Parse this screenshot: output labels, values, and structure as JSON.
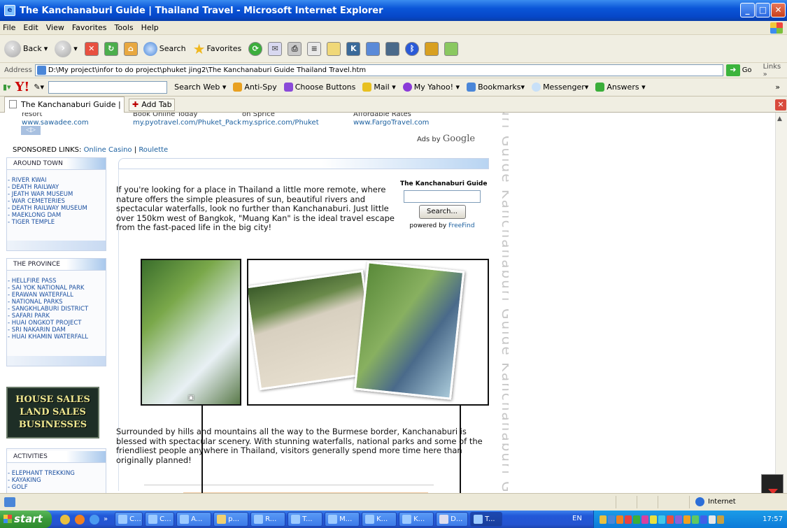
{
  "window": {
    "title": "The Kanchanaburi Guide | Thailand Travel - Microsoft Internet Explorer",
    "controls": [
      "_",
      "□",
      "✕"
    ]
  },
  "menu": [
    "File",
    "Edit",
    "View",
    "Favorites",
    "Tools",
    "Help"
  ],
  "toolbar": {
    "back": "Back",
    "search": "Search",
    "favorites": "Favorites"
  },
  "address": {
    "label": "Address",
    "value": "D:\\My project\\infor to do project\\phuket jing2\\The Kanchanaburi Guide  Thailand Travel.htm",
    "go": "Go",
    "links": "Links »"
  },
  "yahoo": {
    "logo": "Y!",
    "search_web": "Search Web ▾",
    "anti_spy": "Anti-Spy",
    "choose_buttons": "Choose Buttons",
    "mail": "Mail ▾",
    "my_yahoo": "My Yahoo! ▾",
    "bookmarks": "Bookmarks▾",
    "messenger": "Messenger▾",
    "answers": "Answers ▾",
    "more": "»"
  },
  "tabs": {
    "active": "The Kanchanaburi Guide | ...",
    "add": "Add Tab"
  },
  "ads": [
    {
      "line": "resort",
      "url": "www.sawadee.com"
    },
    {
      "line": "Book Online Today",
      "url": "my.pyotravel.com/Phuket_Pack"
    },
    {
      "line": "on Sprice",
      "url": "my.sprice.com/Phuket"
    },
    {
      "line": "Affordable Rates",
      "url": "www.FargoTravel.com"
    }
  ],
  "ads_by": "Ads by",
  "google": "Google",
  "sponsored": {
    "label": "SPONSORED LINKS:",
    "link1": "Online Casino",
    "sep": "|",
    "link2": "Roulette"
  },
  "sidebar": {
    "around_town": {
      "title": "AROUND TOWN",
      "items": [
        "- RIVER KWAI",
        "- DEATH RAILWAY",
        "- JEATH WAR MUSEUM",
        "- WAR CEMETERIES",
        "- DEATH RAILWAY MUSEUM",
        "- MAEKLONG DAM",
        "- TIGER TEMPLE"
      ]
    },
    "province": {
      "title": "THE PROVINCE",
      "items": [
        "- HELLFIRE PASS",
        "- SAI YOK NATIONAL PARK",
        "- ERAWAN WATERFALL",
        "- NATIONAL PARKS",
        "- SANGKHLABURI DISTRICT",
        "- SAFARI PARK",
        "- HUAI ONGKOT PROJECT",
        "- SRI NAKARIN DAM",
        "- HUAI KHAMIN WATERFALL"
      ]
    },
    "banner": [
      "HOUSE SALES",
      "LAND SALES",
      "BUSINESSES"
    ],
    "activities": {
      "title": "ACTIVITIES",
      "items": [
        "- ELEPHANT TREKKING",
        "- KAYAKING",
        "- GOLF"
      ]
    }
  },
  "main": {
    "intro": "If you're looking for a place in Thailand a little more remote, where nature offers the simple pleasures of sun, beautiful rivers and spectacular waterfalls, look no further than Kanchanaburi. Just little over 150km west of Bangkok, \"Muang Kan\" is the ideal travel escape from the fast-paced life in the big city!",
    "second": "Surrounded by hills and mountains all the way to the Burmese border, Kanchanaburi is blessed with spectacular scenery. With stunning waterfalls, national parks and some of the friendliest people anywhere in Thailand, visitors generally spend more time here than originally planned!",
    "watermark": "uri Guide  Kanchanaburi Guide  Kanchanaburi Guide  Kanchanal"
  },
  "freefind": {
    "title": "The Kanchanaburi Guide",
    "button": "Search...",
    "powered": "powered by",
    "brand": "FreeFind"
  },
  "status": {
    "zone": "Internet"
  },
  "taskbar": {
    "start": "start",
    "tasks": [
      "C...",
      "C...",
      "A...",
      "p...",
      "R...",
      "T...",
      "M...",
      "K...",
      "K...",
      "D...",
      "T..."
    ],
    "lang": "EN",
    "clock": "17:57"
  }
}
